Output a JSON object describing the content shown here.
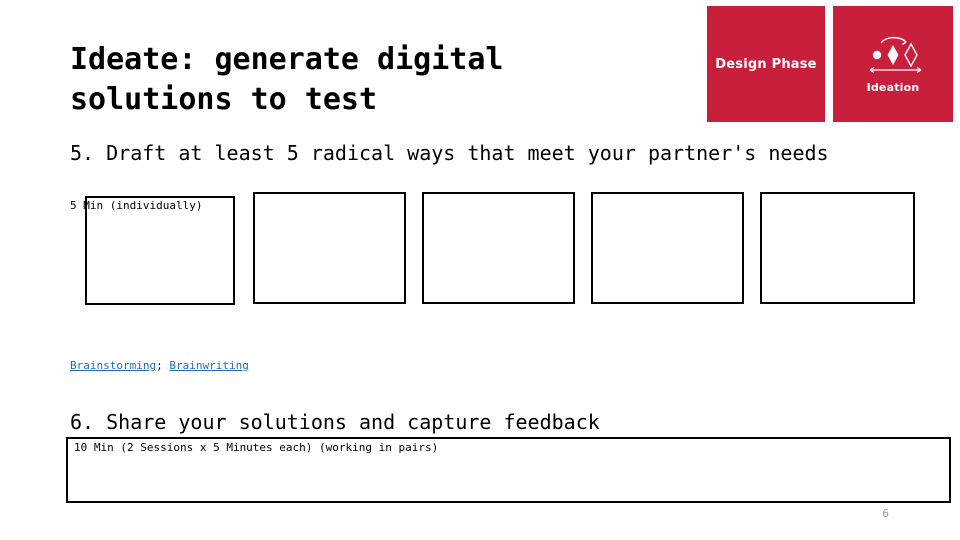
{
  "slide": {
    "title": "Ideate: generate digital solutions to test",
    "page_number": "6"
  },
  "badges": {
    "phase": {
      "label": "Design\nPhase",
      "color": "#c8203c",
      "icon": "none"
    },
    "step": {
      "label": "Ideation",
      "color": "#c8203c",
      "icon": "ideation-diamonds-icon"
    }
  },
  "steps": [
    {
      "heading": "5. Draft at least 5 radical ways that meet your partner's needs",
      "timing": "5 Min (individually)",
      "boxes": [
        "",
        "",
        "",
        "",
        ""
      ]
    },
    {
      "heading": "6. Share your solutions and capture feedback",
      "timing": "10 Min (2 Sessions x 5 Minutes each) (working in pairs)",
      "boxes": [
        ""
      ]
    }
  ],
  "links": {
    "first": "Brainstorming",
    "separator": ";",
    "second": "Brainwriting",
    "color": "#1f6fb5"
  }
}
